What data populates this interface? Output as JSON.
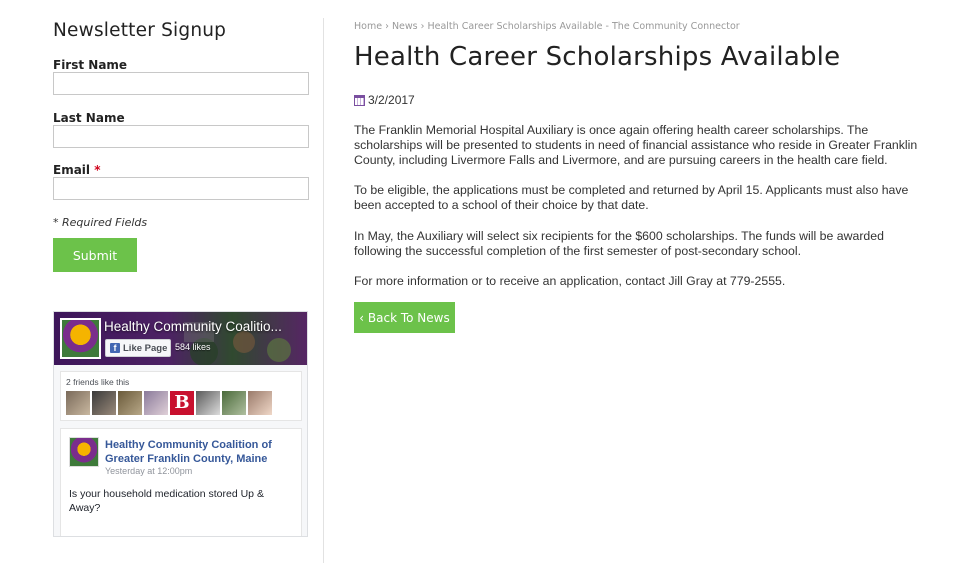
{
  "newsletter": {
    "title": "Newsletter Signup",
    "first_name_label": "First Name",
    "last_name_label": "Last Name",
    "email_label": "Email",
    "required_marker": "*",
    "first_name_value": "",
    "last_name_value": "",
    "email_value": "",
    "required_note": "* Required Fields",
    "submit_label": "Submit"
  },
  "facebook": {
    "page_name": "Healthy Community Coalitio...",
    "like_button": "Like Page",
    "likes": "584 likes",
    "friends_text": "2 friends like this",
    "friend_avatars": [
      "friend-photo-1",
      "friend-photo-2",
      "friend-photo-3",
      "friend-photo-4",
      "friend-photo-5",
      "friend-photo-6",
      "friend-photo-7",
      "friend-photo-8"
    ],
    "post": {
      "author": "Healthy Community Coalition of Greater Franklin County, Maine",
      "time": "Yesterday at 12:00pm",
      "text": "Is your household medication stored Up & Away?"
    }
  },
  "breadcrumb": {
    "home": "Home",
    "sep": "›",
    "news": "News",
    "current": "Health Career Scholarships Available - The Community Connector"
  },
  "article": {
    "title": "Health Career Scholarships Available",
    "date": "3/2/2017",
    "paragraphs": [
      "The Franklin Memorial Hospital Auxiliary is once again offering health career scholarships. The scholarships will be presented to students in need of financial assistance who reside in Greater Franklin County, including Livermore Falls and Livermore, and are pursuing careers in the health care field.",
      "To be eligible, the applications must be completed and returned by April 15. Applicants must also have been accepted to a school of their choice by that date.",
      "In May, the Auxiliary will select six recipients for the $600 scholarships. The funds will be awarded following the successful completion of the first semester of post-secondary school.",
      "For more information or to receive an application, contact Jill Gray at 779-2555."
    ],
    "back_label": "‹ Back To News"
  },
  "colors": {
    "accent_green": "#6cc24a",
    "fb_link_blue": "#365899",
    "calendar_purple": "#7a4fa0"
  }
}
